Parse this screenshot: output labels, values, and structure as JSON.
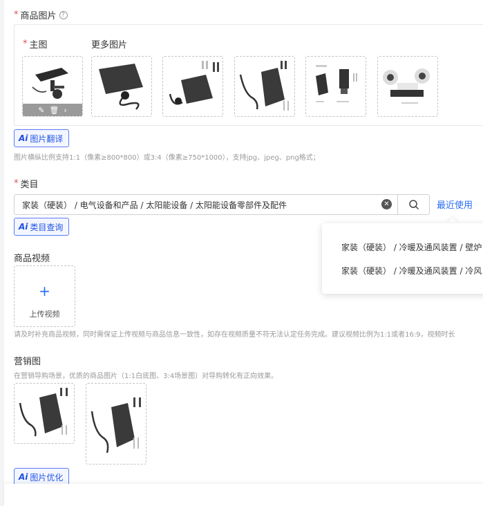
{
  "product_images": {
    "label": "商品图片",
    "help_icon": "help-circle-icon",
    "main_label": "主图",
    "more_label": "更多图片",
    "ai_button": "图片翻译",
    "hint": "图片横纵比例支持1:1（像素≥800*800）或3:4（像素≥750*1000），支持jpg、jpeg、png格式；"
  },
  "category": {
    "label": "类目",
    "value": "家装（硬装） / 电气设备和产品 / 太阳能设备 / 太阳能设备零部件及配件",
    "recent_label": "最近使用",
    "ai_button": "类目查询",
    "recent_items": [
      "家装（硬装） / 冷暖及通风装置 / 壁炉",
      "家装（硬装） / 冷暖及通风装置 / 冷风"
    ]
  },
  "video": {
    "label": "商品视频",
    "upload_label": "上传视频",
    "hint": "请及时补充商品视频，同时需保证上传视频与商品信息一致性，如存在视频质量不符无法认定任务完成。建议视频比例为1:1或者16:9，视频时长"
  },
  "marketing": {
    "label": "营销图",
    "hint": "在营销导购场景，优质的商品图片（1:1白底图、3:4场景图）对导购转化有正向效果。",
    "ai_button": "图片优化"
  },
  "ai_mark": "Ai",
  "colors": {
    "accent": "#2a6ef5",
    "required": "#e34d59",
    "ai_border": "#5b7cf5"
  }
}
